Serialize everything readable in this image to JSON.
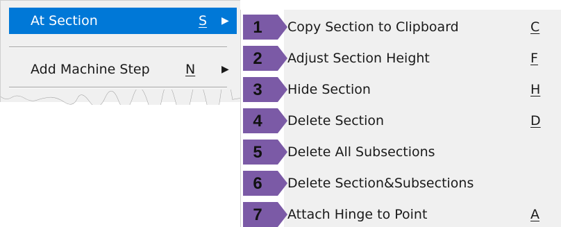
{
  "parent_menu": {
    "items": [
      {
        "label": "At Section",
        "key": "S",
        "arrow": "▶",
        "selected": true
      },
      {
        "label": "Add Machine Step",
        "key": "N",
        "arrow": "▶",
        "selected": false
      }
    ]
  },
  "submenu": {
    "items": [
      {
        "number": "1",
        "label": "Copy Section to Clipboard",
        "shortcut": "C"
      },
      {
        "number": "2",
        "label": "Adjust Section Height",
        "shortcut": "F"
      },
      {
        "number": "3",
        "label": "Hide Section",
        "shortcut": "H"
      },
      {
        "number": "4",
        "label": "Delete Section",
        "shortcut": "D"
      },
      {
        "number": "5",
        "label": "Delete All Subsections",
        "shortcut": ""
      },
      {
        "number": "6",
        "label": "Delete Section&Subsections",
        "shortcut": ""
      },
      {
        "number": "7",
        "label": "Attach Hinge to Point",
        "shortcut": "A"
      }
    ]
  },
  "colors": {
    "selection": "#0078d7",
    "menu_bg": "#f0f0f0",
    "number_tag": "#7b5aa6"
  }
}
